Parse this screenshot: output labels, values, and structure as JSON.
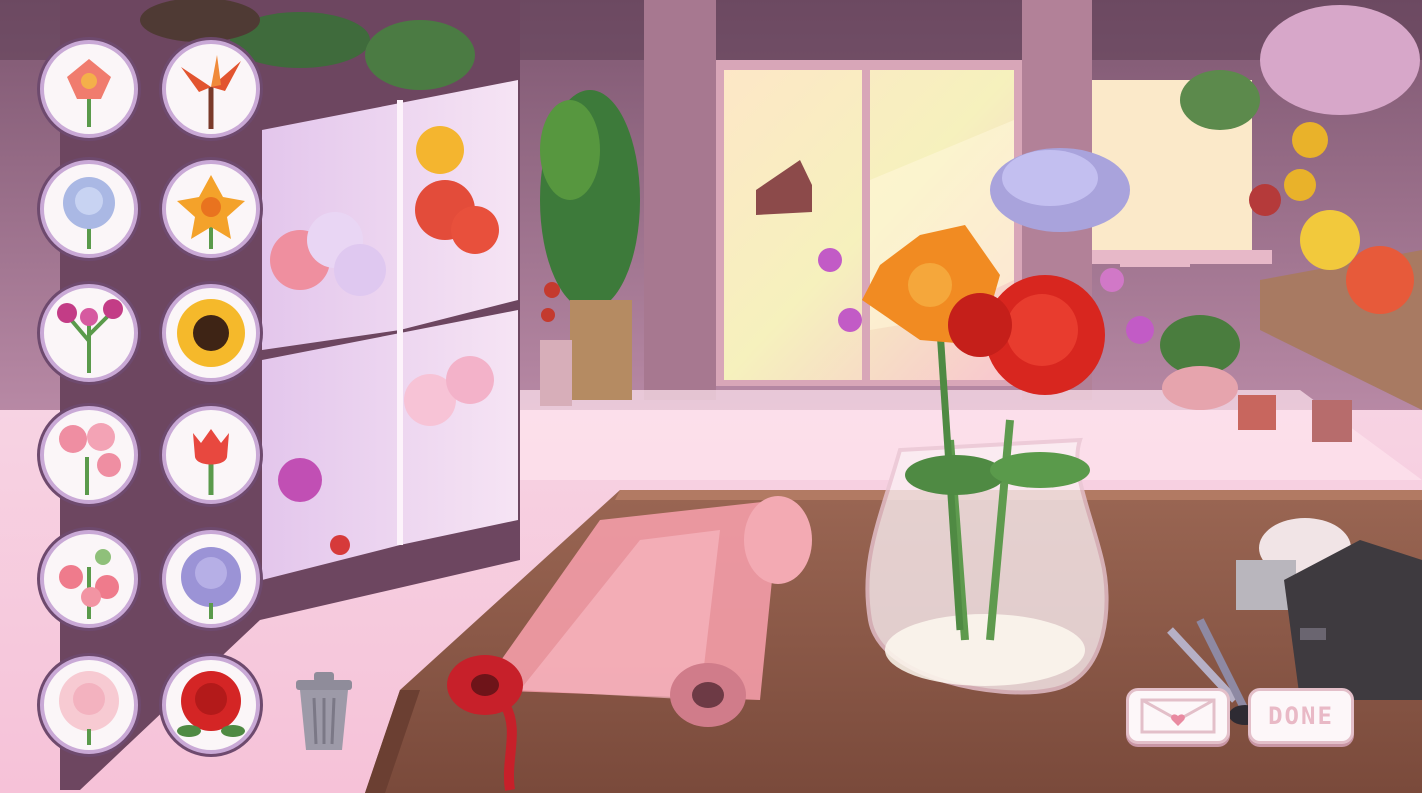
{
  "game": {
    "scene": "flower-shop-counter",
    "palette": {
      "wall": "#9c7088",
      "floor": "#f4c7da",
      "counter": "#8a5745",
      "window_glow": "#fbefc4",
      "ui_ring": "#c9a9d6"
    }
  },
  "flower_picker": [
    {
      "name": "lily-icon",
      "color": "#f07c6e"
    },
    {
      "name": "bird-of-paradise-icon",
      "color": "#e2542f"
    },
    {
      "name": "blue-carnation-icon",
      "color": "#aab8e4"
    },
    {
      "name": "daffodil-icon",
      "color": "#f4a22a"
    },
    {
      "name": "orchid-icon",
      "color": "#c33c86"
    },
    {
      "name": "sunflower-icon",
      "color": "#f5b92b"
    },
    {
      "name": "pink-hydrangea-icon",
      "color": "#ef8ea2"
    },
    {
      "name": "tulip-icon",
      "color": "#e8483f"
    },
    {
      "name": "sweet-pea-icon",
      "color": "#ef7b8c"
    },
    {
      "name": "lavender-carnation-icon",
      "color": "#9b93d6"
    },
    {
      "name": "pink-rose-icon",
      "color": "#f7cad2"
    },
    {
      "name": "red-rose-icon",
      "color": "#d42525"
    }
  ],
  "controls": {
    "trash_icon": "trash-can-icon",
    "letter_icon": "envelope-heart-icon",
    "done_label": "DONE"
  },
  "bouquet": {
    "vase": "glass-vase",
    "flowers": [
      "lavender-carnation",
      "orange-lily",
      "red-rose",
      "red-rose",
      "purple-sweet-pea"
    ]
  }
}
